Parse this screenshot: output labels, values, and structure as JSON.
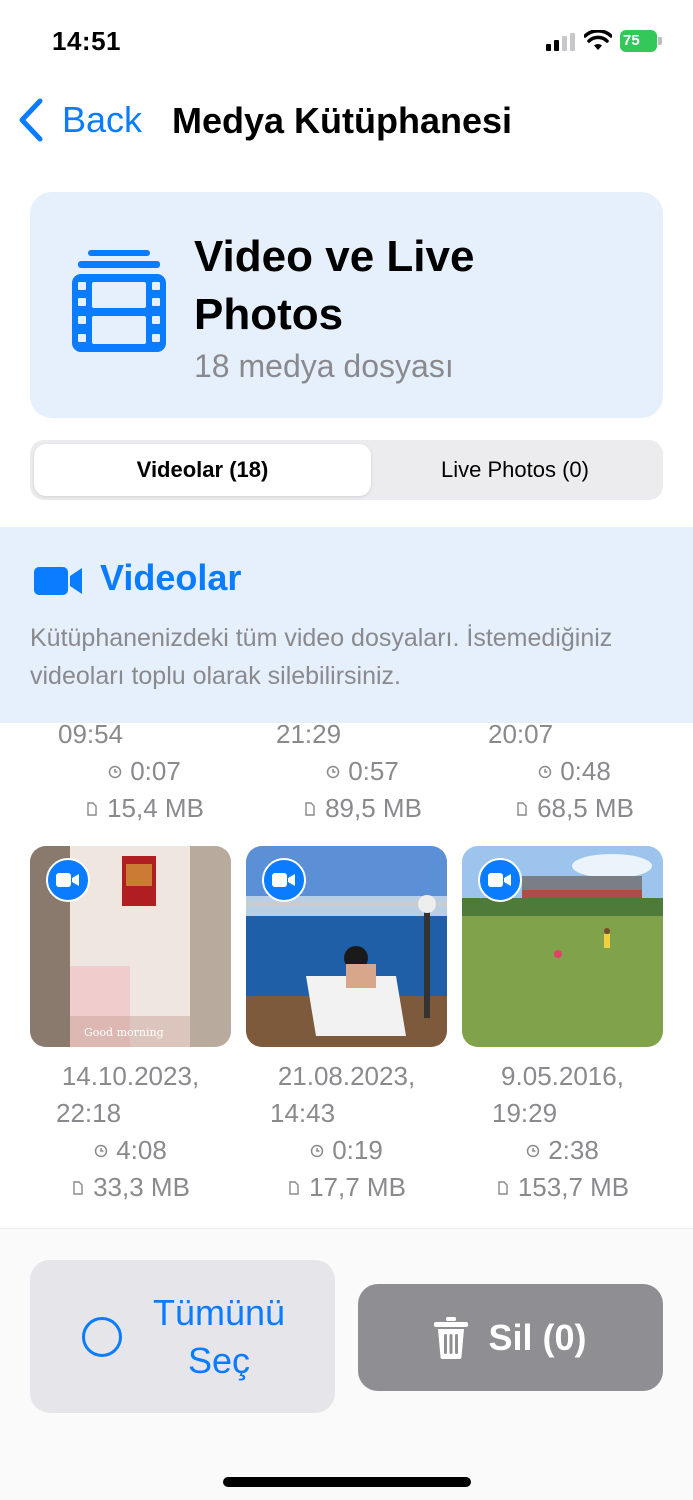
{
  "status_bar": {
    "time": "14:51",
    "battery": "75"
  },
  "nav": {
    "back_label": "Back",
    "title": "Medya Kütüphanesi"
  },
  "header": {
    "title": "Video ve Live Photos",
    "subtitle": "18 medya dosyası"
  },
  "segments": [
    {
      "label": "Videolar (18)",
      "selected": true
    },
    {
      "label": "Live Photos (0)",
      "selected": false
    }
  ],
  "section": {
    "title": "Videolar",
    "description": "Kütüphanenizdeki tüm video dosyaları. İstemediğiniz videoları toplu olarak silebilirsiniz."
  },
  "partial_row": [
    {
      "time": "09:54",
      "duration": "0:07",
      "size": "15,4 MB"
    },
    {
      "time": "21:29",
      "duration": "0:57",
      "size": "89,5 MB"
    },
    {
      "time": "20:07",
      "duration": "0:48",
      "size": "68,5 MB"
    }
  ],
  "videos": [
    {
      "date": "14.10.2023,",
      "time": "22:18",
      "duration": "4:08",
      "size": "33,3 MB",
      "overlay_text": "Good morning"
    },
    {
      "date": "21.08.2023,",
      "time": "14:43",
      "duration": "0:19",
      "size": "17,7 MB"
    },
    {
      "date": "9.05.2016,",
      "time": "19:29",
      "duration": "2:38",
      "size": "153,7 MB"
    }
  ],
  "actions": {
    "select_all_label": "Tümünü Seç",
    "delete_label": "Sil (0)"
  },
  "colors": {
    "accent": "#0a7cff",
    "card_bg": "#e5f0fc",
    "battery": "#34c759",
    "delete_bg": "#8e8e93"
  }
}
